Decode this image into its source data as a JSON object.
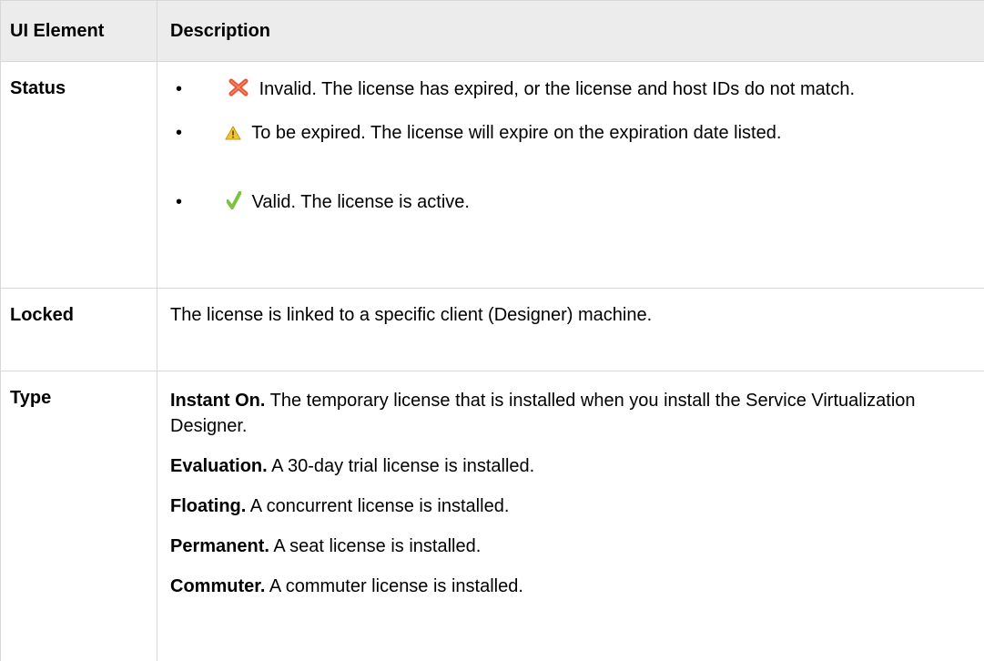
{
  "table": {
    "headers": {
      "element": "UI Element",
      "description": "Description"
    },
    "rows": {
      "status": {
        "element": "Status",
        "items": [
          {
            "icon": "invalid-x-icon",
            "text": "Invalid. The license has expired, or the license and host IDs do not match."
          },
          {
            "icon": "warning-triangle-icon",
            "text": "To be expired. The license will expire on the expiration date listed."
          },
          {
            "icon": "valid-check-icon",
            "text": "Valid. The license is active."
          }
        ]
      },
      "locked": {
        "element": "Locked",
        "description": "The license is linked to a specific client (Designer) machine."
      },
      "type": {
        "element": "Type",
        "entries": [
          {
            "term": "Instant On.",
            "text": " The temporary license that is installed when you install the Service Virtualization Designer."
          },
          {
            "term": "Evaluation.",
            "text": " A 30-day trial license is installed."
          },
          {
            "term": "Floating.",
            "text": " A concurrent license is installed."
          },
          {
            "term": "Permanent.",
            "text": " A seat license is installed."
          },
          {
            "term": "Commuter.",
            "text": " A commuter license is installed."
          }
        ]
      }
    }
  },
  "colors": {
    "header_bg": "#ececec",
    "border": "#d8d8d8",
    "invalid": "#e8532c",
    "warning": "#f2c530",
    "valid": "#7cc243"
  }
}
